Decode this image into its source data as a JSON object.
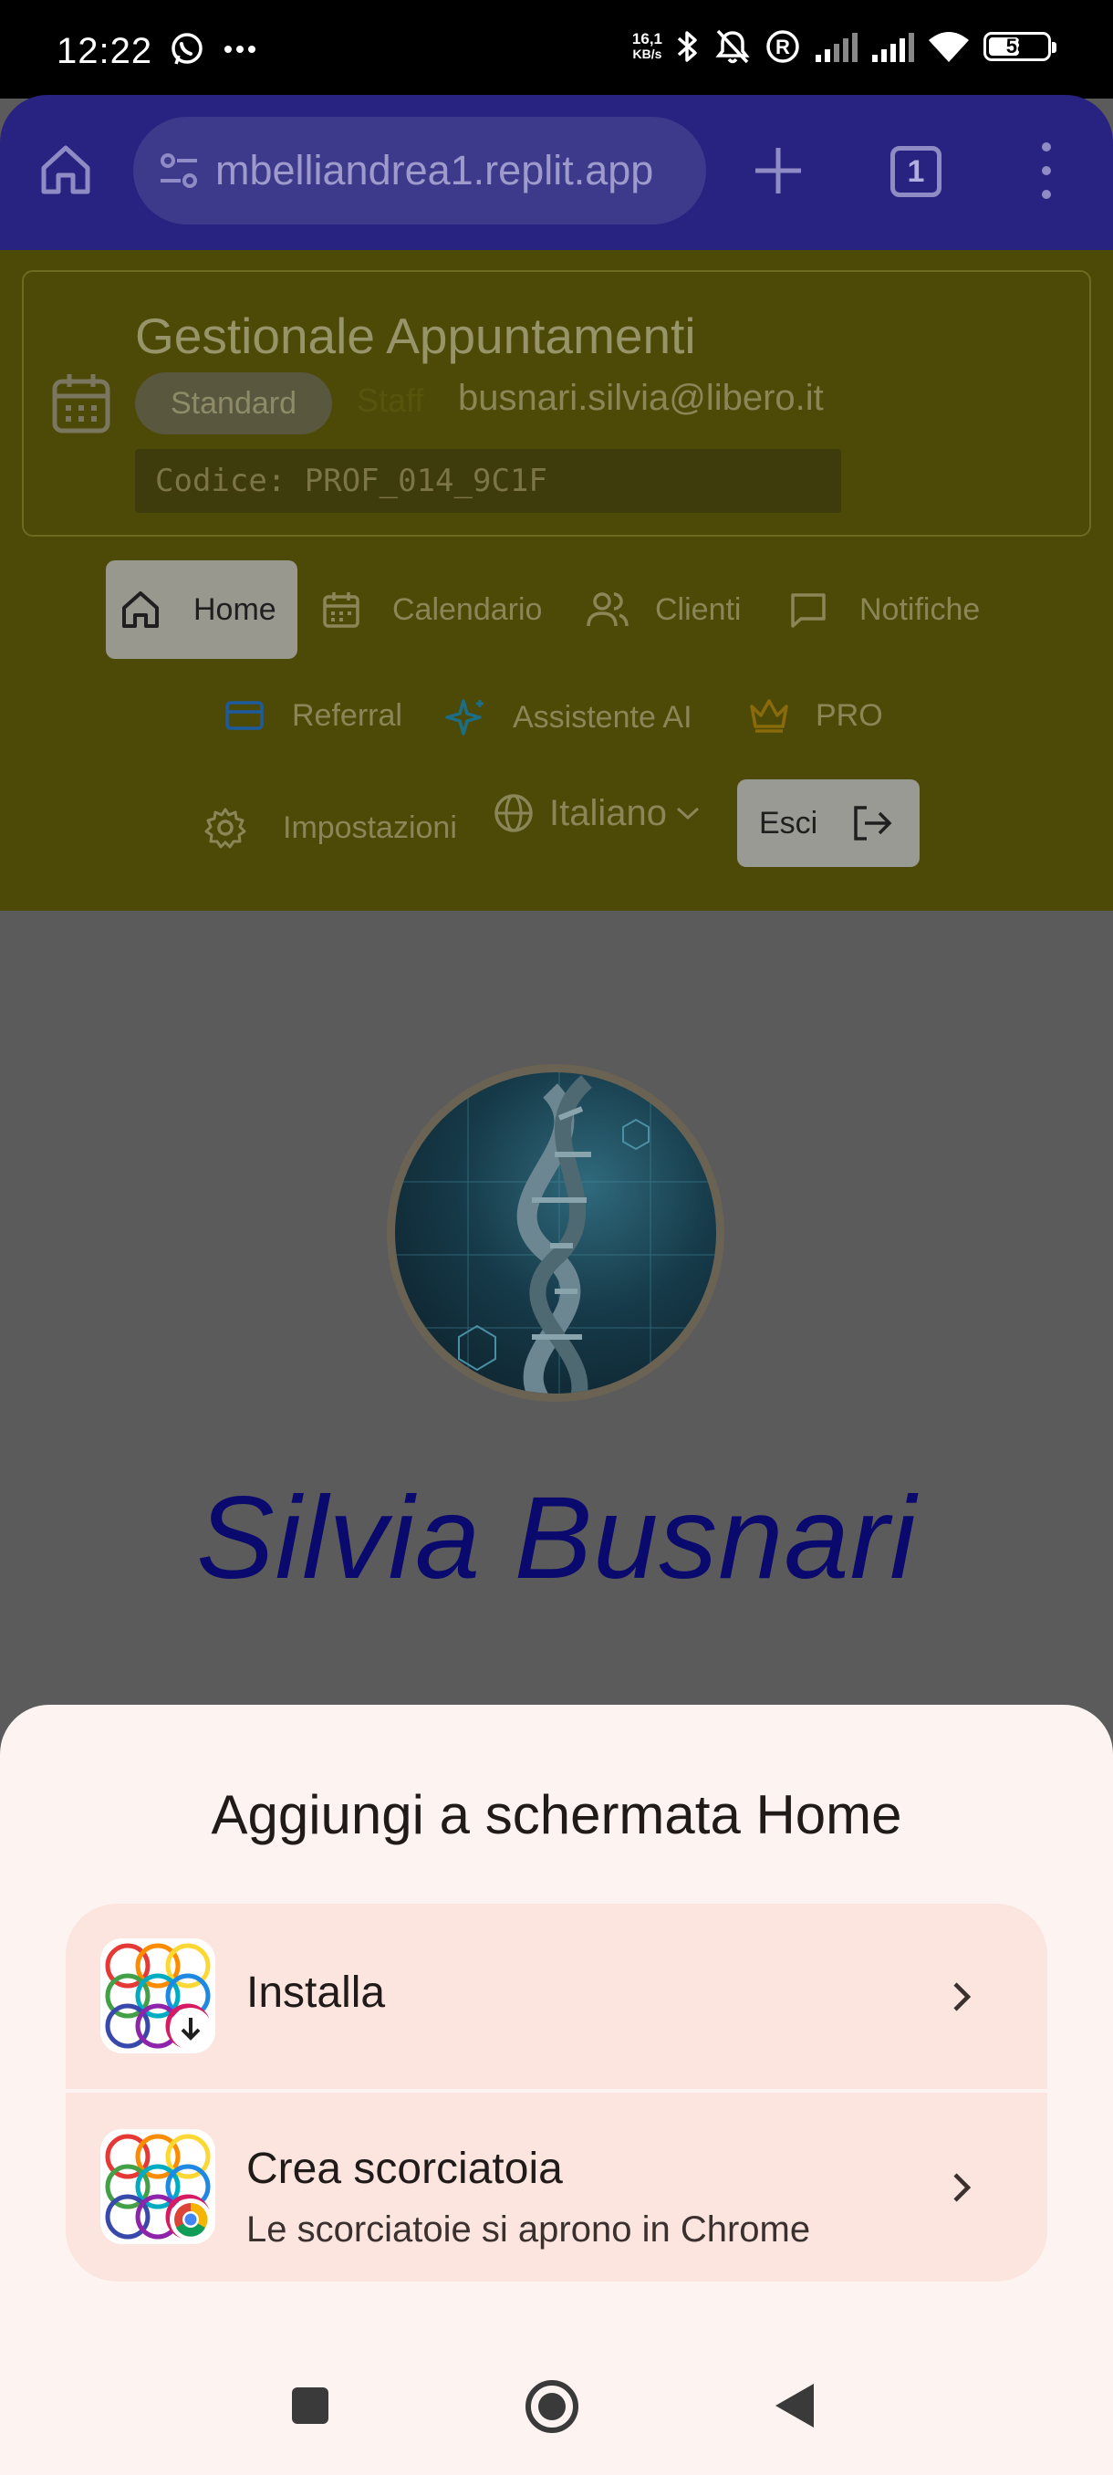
{
  "status_bar": {
    "time": "12:22",
    "net_speed_value": "16,1",
    "net_speed_unit": "KB/s",
    "battery": "58",
    "battery_level": 0.58
  },
  "browser": {
    "url": "mbelliandrea1.replit.app",
    "tab_count": "1",
    "colors": {
      "toolbar": "#282380",
      "url_pill": "#3d3a8c"
    }
  },
  "app": {
    "title": "Gestionale Appuntamenti",
    "plan_badge": "Standard",
    "role_badge": "Staff",
    "email": "busnari.silvia@libero.it",
    "code": "Codice: PROF_014_9C1F",
    "nav": [
      {
        "label": "Home",
        "icon": "home-icon",
        "active": true
      },
      {
        "label": "Calendario",
        "icon": "calendar-icon"
      },
      {
        "label": "Clienti",
        "icon": "users-icon"
      },
      {
        "label": "Notifiche",
        "icon": "message-icon"
      },
      {
        "label": "Referral",
        "icon": "card-icon"
      },
      {
        "label": "Assistente AI",
        "icon": "sparkles-icon"
      },
      {
        "label": "PRO",
        "icon": "crown-icon"
      },
      {
        "label": "Impostazioni",
        "icon": "gear-icon"
      }
    ],
    "language": "Italiano",
    "logout": "Esci"
  },
  "profile": {
    "name": "Silvia Busnari",
    "name_color": "#0a0a6e"
  },
  "sheet": {
    "title": "Aggiungi a schermata Home",
    "install_label": "Installa",
    "shortcut_label": "Crea scorciatoia",
    "shortcut_sub": "Le scorciatoie si aprono in Chrome",
    "colors": {
      "background": "#fdf4f1",
      "option": "#fbe5de"
    }
  }
}
